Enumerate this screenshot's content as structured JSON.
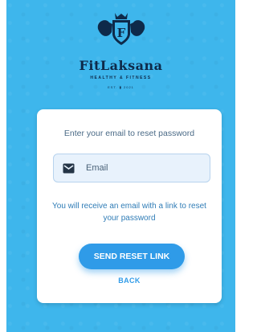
{
  "colors": {
    "background": "#3eb6ec",
    "card": "#ffffff",
    "primary": "#2f9be8",
    "brand_text": "#0e2a4a"
  },
  "brand": {
    "logo_icon": "shield-crown-biceps-logo",
    "logo_letter": "F",
    "name": "FitLaksana",
    "tagline": "HEALTHY & FITNESS",
    "est_left": "EST.",
    "est_right": "2021"
  },
  "reset_form": {
    "heading": "Enter your email to reset password",
    "email_icon": "mail-icon",
    "email_placeholder": "Email",
    "info_text": "You will receive an email with a link to reset your password",
    "send_button_label": "SEND RESET LINK",
    "back_label": "BACK"
  }
}
